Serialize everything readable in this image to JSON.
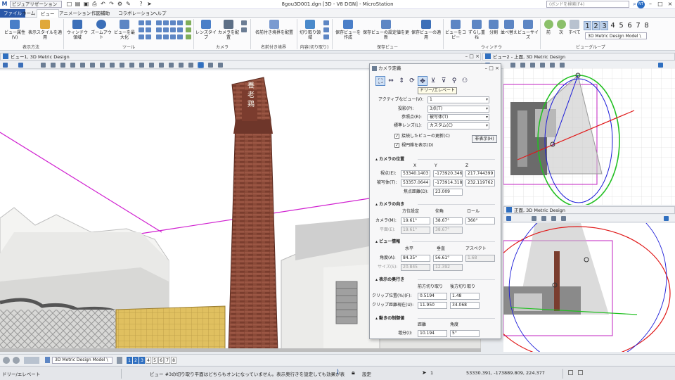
{
  "titlebar": {
    "workflow": "ビジュアリゼーション",
    "title": "8gou3D001.dgn [3D - V8 DGN] - MicroStation",
    "search_placeholder": "(ボンドを検索(F4)",
    "user_initials": "NT"
  },
  "tabs": [
    "ファイル",
    "ホーム",
    "ビュー",
    "アニメーション",
    "作図補助",
    "コラボレーション",
    "ヘルプ"
  ],
  "ribbon": {
    "buttons": {
      "view_attr": "ビュー属性(V)",
      "display_style": "表示スタイルを適用",
      "window_area": "ウィンドウ領域",
      "zoom_out": "ズームアウト",
      "fit_view": "ビューを最大化",
      "lens_type": "レンズタイプ",
      "place_camera": "カメラを配置",
      "named_boundary": "名前付き境界を配置",
      "clip_volume": "切り取り領域",
      "save_view_create": "保存ビューを作成",
      "save_view_update": "保存ビューの設定値を更新",
      "save_view_apply": "保存ビューの適用",
      "copy_view": "ビューをコピー",
      "tile": "ずらし重ね",
      "split": "分割",
      "arrange": "並べ替え",
      "view_size": "ビューサイズ"
    },
    "groups": {
      "display_method": "表示方法",
      "tools": "ツール",
      "camera": "カメラ",
      "named_boundary": "名前付き境界",
      "clip": "内容(切り取り)",
      "saved_views": "保存ビュー",
      "window": "ウィンドウ",
      "view_group": "ビューグループ"
    },
    "nav": {
      "back": "前",
      "forward": "次",
      "all": "すべて"
    },
    "view_numbers": [
      "1",
      "2",
      "3",
      "4",
      "5",
      "6",
      "7",
      "8"
    ],
    "view_model": "3D Metric Design Model \\"
  },
  "views": {
    "v1_title": "ビュー1, 3D Metric Design",
    "v2_title": "ビュー2 - 上面, 3D Metric Design",
    "v3_title": "正面, 3D Metric Design",
    "chimney_text": "養 老 鶏"
  },
  "dialog": {
    "title": "カメラ定義",
    "tooltip": "ドリー/エレベート",
    "active_view_label": "アクティブなビュー(V):",
    "active_view_value": "1",
    "projection_label": "投影(P):",
    "projection_value": "3点(T)",
    "ref_point_label": "参照点(R):",
    "ref_point_value": "被写体(T)",
    "lens_label": "標準レンズ(L):",
    "lens_value": "カスタム(C)",
    "chk_update": "接続したビューの更新(C)",
    "chk_frustum": "視円錐を表示(D)",
    "hide_button": "非表示(H)",
    "sec_cam_pos": "カメラの位置",
    "col_x": "X",
    "col_y": "Y",
    "col_z": "Z",
    "eye_label": "視点(E):",
    "eye": [
      "53340.1403",
      "-173920.346",
      "217.744399"
    ],
    "target_label": "被写体(T):",
    "target": [
      "53357.0644",
      "-173914.318",
      "232.119762"
    ],
    "focal_label": "焦点距離(D):",
    "focal": "23.009",
    "sec_cam_dir": "カメラの向き",
    "dir_cols": [
      "方位設定",
      "仰角",
      "ロール"
    ],
    "camera_label": "カメラ(M):",
    "camera": [
      "19.61°",
      "38.67°",
      "360°"
    ],
    "plane_label": "平面(E):",
    "plane": [
      "19.61°",
      "38.67°"
    ],
    "sec_view_info": "ビュー情報",
    "view_cols": [
      "水平",
      "垂直",
      "アスペクト"
    ],
    "angle_label": "角度(A):",
    "angle": [
      "84.35°",
      "56.61°",
      "1.68"
    ],
    "size_label": "サイズ(S):",
    "size": [
      "20.845",
      "12.392"
    ],
    "sec_depth": "表示の奥行き",
    "depth_cols": [
      "前方切り取り",
      "後方切り取り"
    ],
    "clip_pos_label": "クリップ位置(%)(F):",
    "clip_pos": [
      "0.5194",
      "1.48"
    ],
    "clip_dist_label": "クリップ距離現在(U):",
    "clip_dist": [
      "11.950",
      "34.068"
    ],
    "sec_motion": "動きの制御値",
    "motion_cols": [
      "距離",
      "角度"
    ],
    "incr_label": "増分(I):",
    "incr": [
      "10.194",
      "5°"
    ]
  },
  "bottombar": {
    "model": "3D Metric Design Model \\",
    "view_numbers": [
      "1",
      "2",
      "3",
      "4",
      "5",
      "6",
      "7",
      "8"
    ]
  },
  "status": {
    "tool": "ドリー/エレベート",
    "message": "ビュー #3の切り取り平面はどちらもオンになっていません。表示奥行きを設定しても効果が表",
    "lock": "設定",
    "level": "1",
    "coords": "53330.391, -173889.809, 224.377"
  },
  "colors": {
    "accent": "#2a58a8",
    "magenta": "#d020d0",
    "green": "#22c022",
    "red": "#e01818",
    "blue": "#1a1ad8"
  }
}
